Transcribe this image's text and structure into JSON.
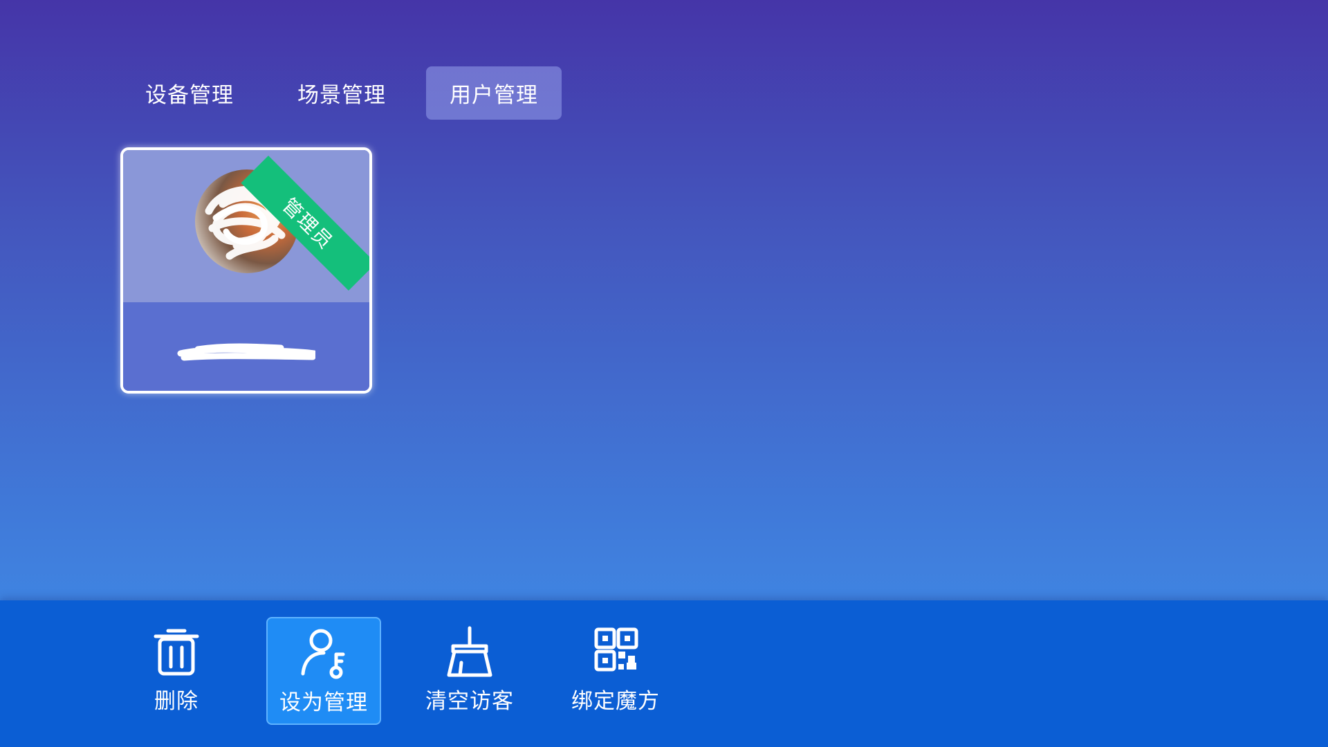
{
  "tabs": [
    {
      "label": "设备管理",
      "active": false
    },
    {
      "label": "场景管理",
      "active": false
    },
    {
      "label": "用户管理",
      "active": true
    }
  ],
  "user_card": {
    "badge": "管理员",
    "badge_color": "#14bf7b",
    "avatar_icon": "user-avatar-photo",
    "name_redacted": true
  },
  "toolbar": {
    "items": [
      {
        "label": "删除",
        "icon": "trash-icon",
        "active": false
      },
      {
        "label": "设为管理",
        "icon": "user-key-icon",
        "active": true
      },
      {
        "label": "清空访客",
        "icon": "broom-icon",
        "active": false
      },
      {
        "label": "绑定魔方",
        "icon": "qr-code-icon",
        "active": false
      }
    ]
  },
  "colors": {
    "toolbar_bg": "#0b5ed4",
    "toolbar_active": "#1f8cf5",
    "tab_active": "rgba(150,160,235,0.55)"
  }
}
